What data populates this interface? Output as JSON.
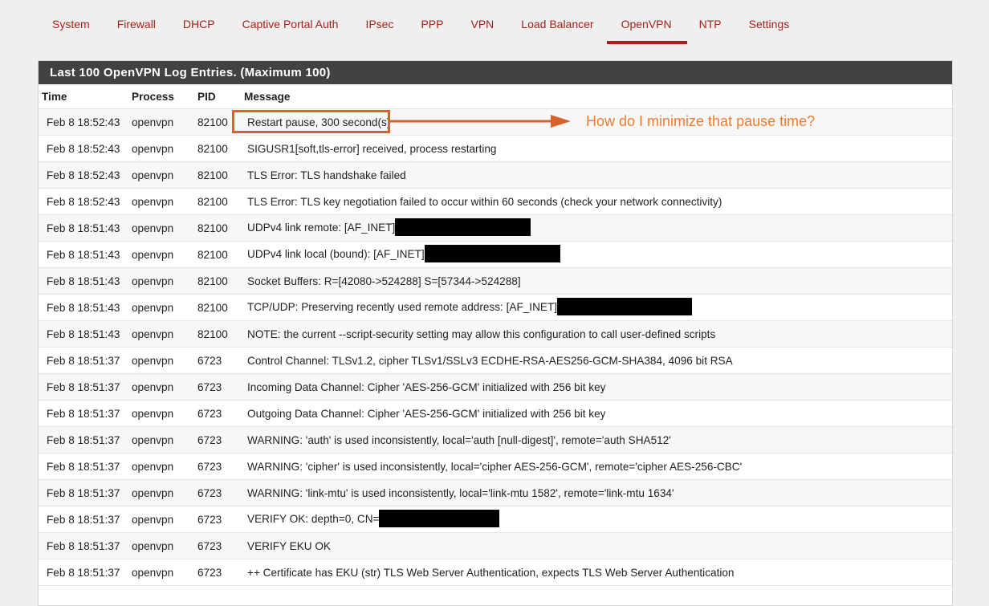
{
  "nav": {
    "tabs": [
      {
        "label": "System"
      },
      {
        "label": "Firewall"
      },
      {
        "label": "DHCP"
      },
      {
        "label": "Captive Portal Auth"
      },
      {
        "label": "IPsec"
      },
      {
        "label": "PPP"
      },
      {
        "label": "VPN"
      },
      {
        "label": "Load Balancer"
      },
      {
        "label": "OpenVPN"
      },
      {
        "label": "NTP"
      },
      {
        "label": "Settings"
      }
    ],
    "active": "OpenVPN"
  },
  "panel": {
    "title": "Last 100 OpenVPN Log Entries. (Maximum 100)"
  },
  "table": {
    "headers": {
      "time": "Time",
      "process": "Process",
      "pid": "PID",
      "message": "Message"
    },
    "rows": [
      {
        "time": "Feb 8 18:52:43",
        "process": "openvpn",
        "pid": "82100",
        "message": "Restart pause, 300 second(s)"
      },
      {
        "time": "Feb 8 18:52:43",
        "process": "openvpn",
        "pid": "82100",
        "message": "SIGUSR1[soft,tls-error] received, process restarting"
      },
      {
        "time": "Feb 8 18:52:43",
        "process": "openvpn",
        "pid": "82100",
        "message": "TLS Error: TLS handshake failed"
      },
      {
        "time": "Feb 8 18:52:43",
        "process": "openvpn",
        "pid": "82100",
        "message": "TLS Error: TLS key negotiation failed to occur within 60 seconds (check your network connectivity)"
      },
      {
        "time": "Feb 8 18:51:43",
        "process": "openvpn",
        "pid": "82100",
        "message": "UDPv4 link remote: [AF_INET]"
      },
      {
        "time": "Feb 8 18:51:43",
        "process": "openvpn",
        "pid": "82100",
        "message": "UDPv4 link local (bound): [AF_INET]"
      },
      {
        "time": "Feb 8 18:51:43",
        "process": "openvpn",
        "pid": "82100",
        "message": "Socket Buffers: R=[42080->524288] S=[57344->524288]"
      },
      {
        "time": "Feb 8 18:51:43",
        "process": "openvpn",
        "pid": "82100",
        "message": "TCP/UDP: Preserving recently used remote address: [AF_INET]"
      },
      {
        "time": "Feb 8 18:51:43",
        "process": "openvpn",
        "pid": "82100",
        "message": "NOTE: the current --script-security setting may allow this configuration to call user-defined scripts"
      },
      {
        "time": "Feb 8 18:51:37",
        "process": "openvpn",
        "pid": "6723",
        "message": "Control Channel: TLSv1.2, cipher TLSv1/SSLv3 ECDHE-RSA-AES256-GCM-SHA384, 4096 bit RSA"
      },
      {
        "time": "Feb 8 18:51:37",
        "process": "openvpn",
        "pid": "6723",
        "message": "Incoming Data Channel: Cipher 'AES-256-GCM' initialized with 256 bit key"
      },
      {
        "time": "Feb 8 18:51:37",
        "process": "openvpn",
        "pid": "6723",
        "message": "Outgoing Data Channel: Cipher 'AES-256-GCM' initialized with 256 bit key"
      },
      {
        "time": "Feb 8 18:51:37",
        "process": "openvpn",
        "pid": "6723",
        "message": "WARNING: 'auth' is used inconsistently, local='auth [null-digest]', remote='auth SHA512'"
      },
      {
        "time": "Feb 8 18:51:37",
        "process": "openvpn",
        "pid": "6723",
        "message": "WARNING: 'cipher' is used inconsistently, local='cipher AES-256-GCM', remote='cipher AES-256-CBC'"
      },
      {
        "time": "Feb 8 18:51:37",
        "process": "openvpn",
        "pid": "6723",
        "message": "WARNING: 'link-mtu' is used inconsistently, local='link-mtu 1582', remote='link-mtu 1634'"
      },
      {
        "time": "Feb 8 18:51:37",
        "process": "openvpn",
        "pid": "6723",
        "message": "VERIFY OK: depth=0, CN="
      },
      {
        "time": "Feb 8 18:51:37",
        "process": "openvpn",
        "pid": "6723",
        "message": "VERIFY EKU OK"
      },
      {
        "time": "Feb 8 18:51:37",
        "process": "openvpn",
        "pid": "6723",
        "message": "++ Certificate has EKU (str) TLS Web Server Authentication, expects TLS Web Server Authentication"
      }
    ]
  },
  "annotation": {
    "note": "How do I minimize that pause time?",
    "color": "#d9622a"
  },
  "colors": {
    "accent": "#a5231b",
    "header_bg": "#424242"
  }
}
